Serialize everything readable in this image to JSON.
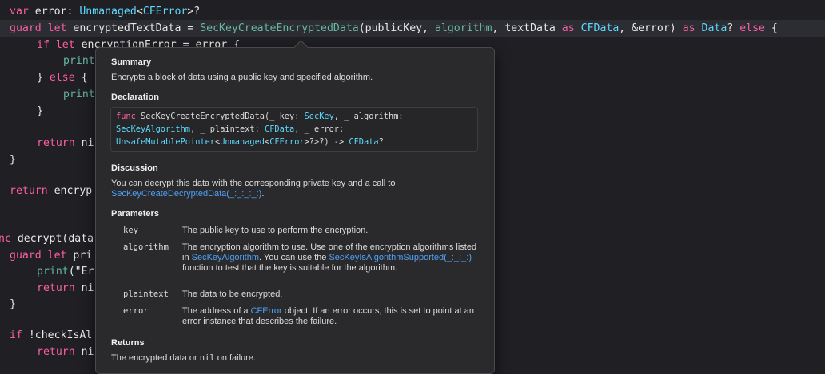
{
  "code": {
    "l1": {
      "a": "var",
      "b": " error: ",
      "c": "Unmanaged",
      "d": "<",
      "e": "CFError",
      ">": ">?"
    },
    "l2": {
      "k1": "guard",
      "k2": " let",
      "t1": " encryptedTextData = ",
      "f1": "SecKeyCreateEncryptedData",
      "t2": "(publicKey, ",
      "f2": "algorithm",
      "t3": ", textData ",
      "k3": "as",
      "t4": " ",
      "y1": "CFData",
      "t5": ", &error) ",
      "k4": "as",
      "t6": " ",
      "y2": "Data",
      "t7": "? ",
      "k5": "else",
      "t8": " {"
    },
    "l3": {
      "k": "if let",
      "t": " encryptionError = error {"
    },
    "l4": {
      "t": "print"
    },
    "l5": {
      "t": "} ",
      "k": "else",
      "t2": " {"
    },
    "l6": {
      "t": "print"
    },
    "l7": {
      "t": "}"
    },
    "l8": {
      "k": "return",
      "t": " ni"
    },
    "l9": {
      "t": "}"
    },
    "l10": {
      "k": "return",
      "t": " encryp"
    },
    "l11": {
      "k": "nc",
      "t": " decrypt(data"
    },
    "l12": {
      "k": "guard let",
      "t": " pri"
    },
    "l13": {
      "f": "print",
      "t": "(\"Er"
    },
    "l14": {
      "k": "return",
      "t": " ni"
    },
    "l15": {
      "t": "}"
    },
    "l16": {
      "k": "if",
      "t": " !checkIsAl"
    },
    "l17": {
      "k": "return",
      "t": " ni"
    }
  },
  "quickhelp": {
    "summary_heading": "Summary",
    "summary_text": "Encrypts a block of data using a public key and specified algorithm.",
    "declaration_heading": "Declaration",
    "decl": {
      "l1a": "func",
      "l1b": " SecKeyCreateEncryptedData(_ key: ",
      "l1c": "SecKey",
      "l1d": ", _ algorithm:",
      "l2a": "SecKeyAlgorithm",
      "l2b": ", _ plaintext: ",
      "l2c": "CFData",
      "l2d": ", _ error:",
      "l3a": "UnsafeMutablePointer",
      "l3b": "<",
      "l3c": "Unmanaged",
      "l3d": "<",
      "l3e": "CFError",
      "l3f": ">?>?) -> ",
      "l3g": "CFData",
      "l3h": "?"
    },
    "discussion_heading": "Discussion",
    "discussion_text": "You can decrypt this data with the corresponding private key and a call to",
    "discussion_link": "SecKeyCreateDecryptedData(_:_:_:_:)",
    "discussion_end": ".",
    "parameters_heading": "Parameters",
    "params": [
      {
        "name": "key",
        "desc": "The public key to use to perform the encryption."
      },
      {
        "name": "algorithm",
        "desc_a": "The encryption algorithm to use. Use one of the encryption algorithms listed in ",
        "link1": "SecKeyAlgorithm",
        "desc_b": ". You can use the ",
        "link2": "SecKeyIsAlgorithmSupported(_:_:_:)",
        "desc_c": " function to test that the key is suitable for the algorithm."
      },
      {
        "name": "plaintext",
        "desc": "The data to be encrypted."
      },
      {
        "name": "error",
        "desc_a": "The address of a ",
        "link1": "CFError",
        "desc_b": " object. If an error occurs, this is set to point at an error instance that describes the failure."
      }
    ],
    "returns_heading": "Returns",
    "returns_a": "The encrypted data or ",
    "returns_mono": "nil",
    "returns_b": " on failure."
  },
  "colors": {
    "keyword": "#fc5fa3",
    "type": "#5dd8ff",
    "function": "#67b7a4",
    "link": "#4ea1f7"
  }
}
